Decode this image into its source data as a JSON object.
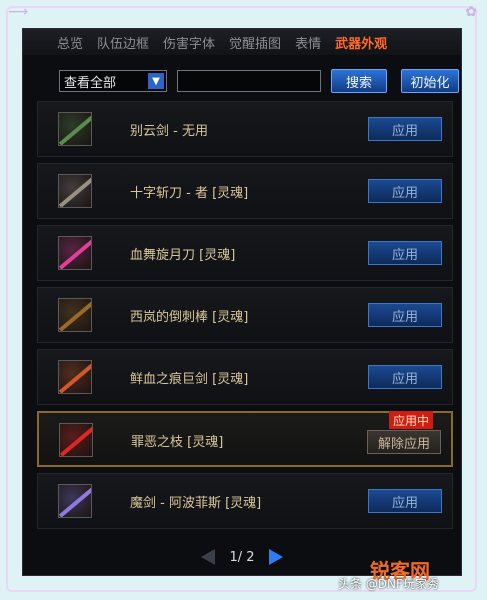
{
  "tabs": [
    {
      "label": "总览"
    },
    {
      "label": "队伍边框"
    },
    {
      "label": "伤害字体"
    },
    {
      "label": "觉醒插图"
    },
    {
      "label": "表情"
    },
    {
      "label": "武器外观",
      "active": true
    }
  ],
  "toolbar": {
    "filter_value": "查看全部",
    "search_value": "",
    "search_label": "搜索",
    "reset_label": "初始化"
  },
  "items": [
    {
      "name": "别云剑 - 无用",
      "button": "应用",
      "thumb_color": "#5d8a4e"
    },
    {
      "name": "十字斩刀 - 者 [灵魂]",
      "button": "应用",
      "thumb_color": "#9a8f84"
    },
    {
      "name": "血舞旋月刀 [灵魂]",
      "button": "应用",
      "thumb_color": "#e0409a"
    },
    {
      "name": "西岚的倒刺棒 [灵魂]",
      "button": "应用",
      "thumb_color": "#9a6a2a"
    },
    {
      "name": "鲜血之痕巨剑 [灵魂]",
      "button": "应用",
      "thumb_color": "#d0582a"
    },
    {
      "name": "罪恶之枝 [灵魂]",
      "button": "解除应用",
      "badge": "应用中",
      "selected": true,
      "thumb_color": "#e02626"
    },
    {
      "name": "魔剑 - 阿波菲斯 [灵魂]",
      "button": "应用",
      "thumb_color": "#8f7ae0"
    }
  ],
  "pager": {
    "label": "1/ 2"
  },
  "watermark": {
    "logo": "锐客网",
    "text": "头条 @DNF玩家秀"
  }
}
